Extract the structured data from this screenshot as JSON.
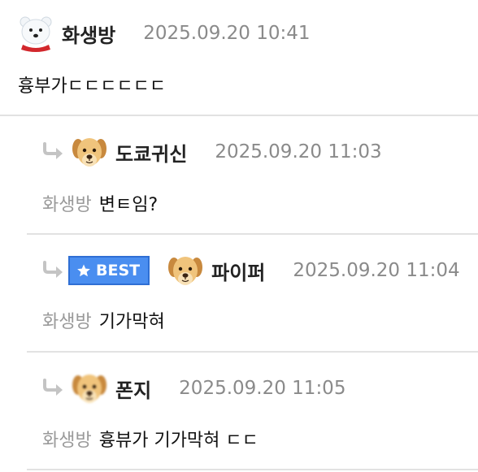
{
  "colors": {
    "best_badge": "#4a8ef0",
    "divider": "#e2e2e2",
    "mention": "#9a9a9a",
    "time": "#8a8a8a"
  },
  "comments": [
    {
      "author": "화생방",
      "time": "2025.09.20 10:41",
      "text": "흉부가ㄷㄷㄷㄷㄷㄷ",
      "avatar": "polar-bear-icon"
    },
    {
      "author": "도쿄귀신",
      "time": "2025.09.20 11:03",
      "mention": "화생방",
      "text": "변ㅌ임?",
      "avatar": "puppy-icon"
    },
    {
      "author": "파이퍼",
      "badge": "BEST",
      "time": "2025.09.20 11:04",
      "mention": "화생방",
      "text": "기가막혀",
      "avatar": "puppy-icon"
    },
    {
      "author": "폰지",
      "time": "2025.09.20 11:05",
      "mention": "화생방",
      "text": "흉뷰가 기가막혀 ㄷㄷ",
      "avatar": "puppy-blurred-icon"
    }
  ]
}
